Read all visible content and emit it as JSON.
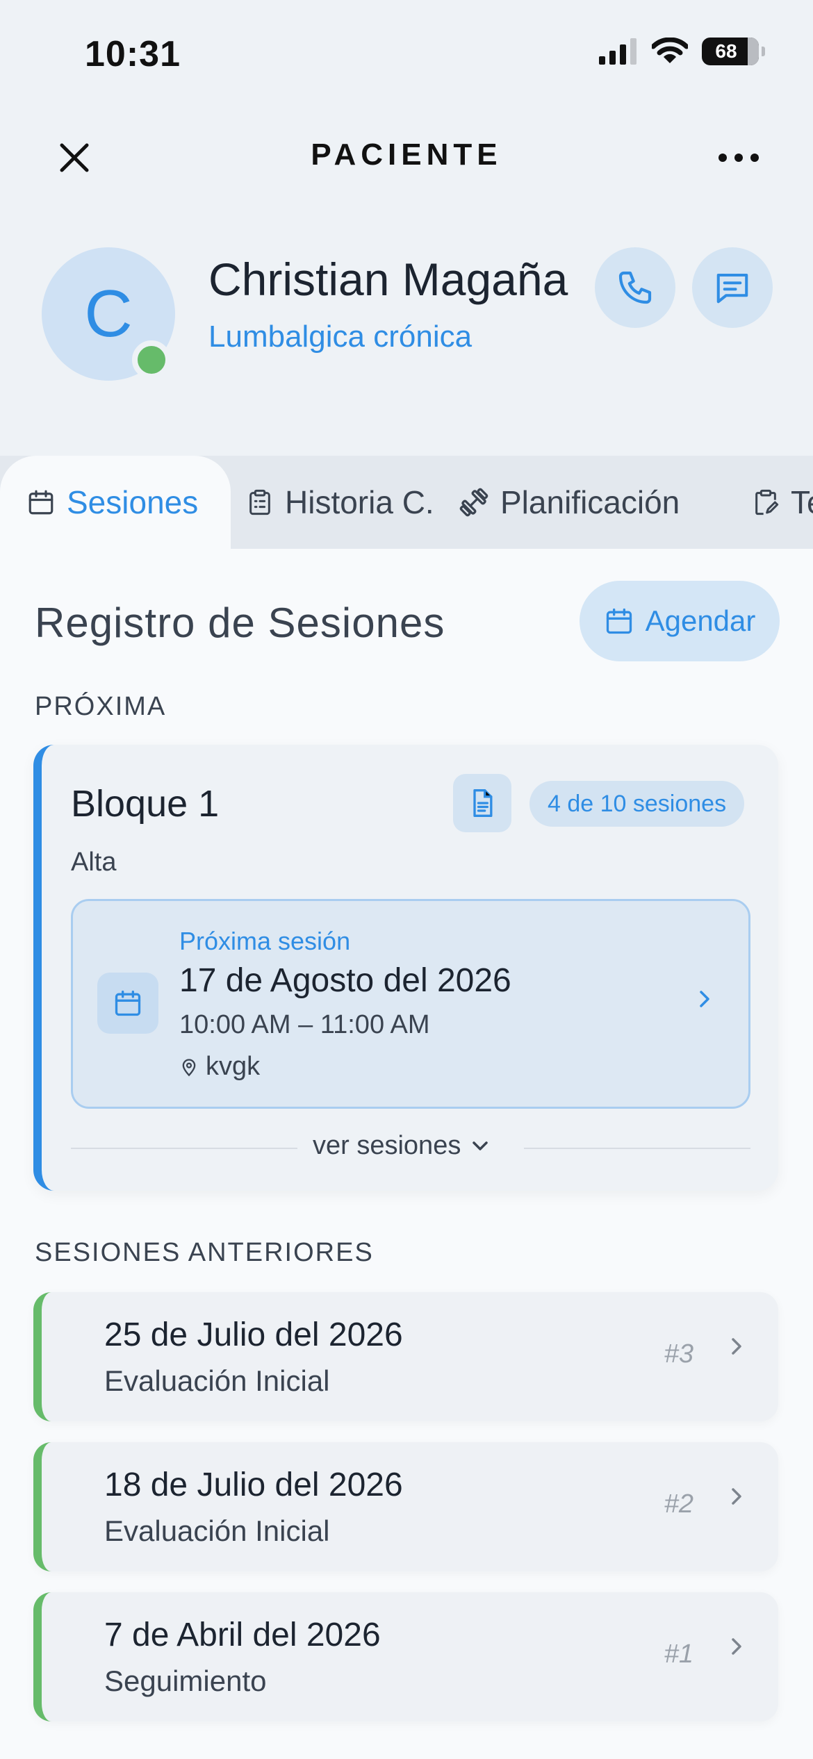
{
  "status_bar": {
    "time": "10:31",
    "battery": "68"
  },
  "header": {
    "title": "PACIENTE"
  },
  "patient": {
    "initial": "C",
    "name": "Christian Magaña",
    "diagnosis": "Lumbalgica crónica",
    "online_color": "#66bb6a"
  },
  "tabs": [
    {
      "label": "Sesiones",
      "icon": "calendar-icon",
      "active": true
    },
    {
      "label": "Historia C.",
      "icon": "clipboard-list-icon",
      "active": false
    },
    {
      "label": "Planificación",
      "icon": "dumbbell-icon",
      "active": false
    },
    {
      "label": "Te",
      "icon": "clipboard-edit-icon",
      "active": false
    }
  ],
  "content": {
    "section_title": "Registro de Sesiones",
    "agendar_label": "Agendar",
    "next_label": "PRÓXIMA",
    "previous_label": "SESIONES ANTERIORES"
  },
  "block": {
    "title": "Bloque 1",
    "subtitle": "Alta",
    "sessions_badge": "4 de 10 sesiones",
    "next_session": {
      "label": "Próxima sesión",
      "date": "17 de Agosto del 2026",
      "time": "10:00 AM – 11:00 AM",
      "location": "kvgk"
    },
    "ver_sesiones": "ver sesiones"
  },
  "previous_sessions": [
    {
      "date": "25 de Julio del 2026",
      "type": "Evaluación Inicial",
      "number": "#3"
    },
    {
      "date": "18 de Julio del 2026",
      "type": "Evaluación Inicial",
      "number": "#2"
    },
    {
      "date": "7 de Abril del 2026",
      "type": "Seguimiento",
      "number": "#1"
    }
  ],
  "colors": {
    "accent": "#2f8de4",
    "success": "#66bb6a",
    "background": "#eef2f6"
  }
}
